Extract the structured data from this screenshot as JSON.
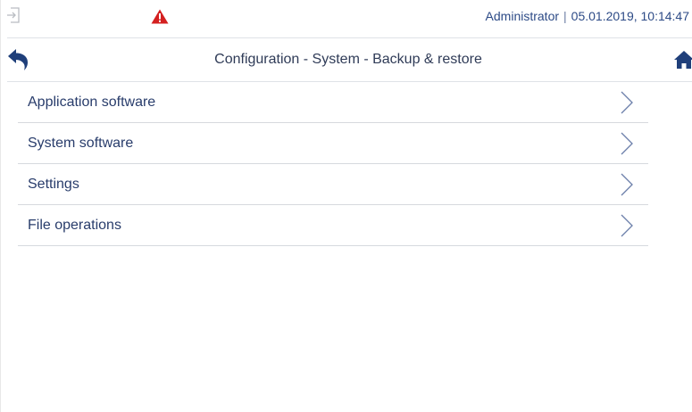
{
  "status_bar": {
    "user": "Administrator",
    "separator": "|",
    "datetime": "05.01.2019, 10:14:47",
    "icons": {
      "login": "login-icon",
      "warning": "warning-triangle-icon"
    },
    "colors": {
      "warning": "#d42020",
      "text": "#2c4a86"
    }
  },
  "header": {
    "title": "Configuration - System - Backup & restore",
    "icons": {
      "back": "back-arrow-icon",
      "home": "home-icon"
    },
    "colors": {
      "icon": "#1f3f7a"
    }
  },
  "menu": {
    "items": [
      {
        "label": "Application software",
        "icon": "chevron-right-icon"
      },
      {
        "label": "System software",
        "icon": "chevron-right-icon"
      },
      {
        "label": "Settings",
        "icon": "chevron-right-icon"
      },
      {
        "label": "File operations",
        "icon": "chevron-right-icon"
      }
    ],
    "colors": {
      "chevron": "#6b7faa"
    }
  }
}
